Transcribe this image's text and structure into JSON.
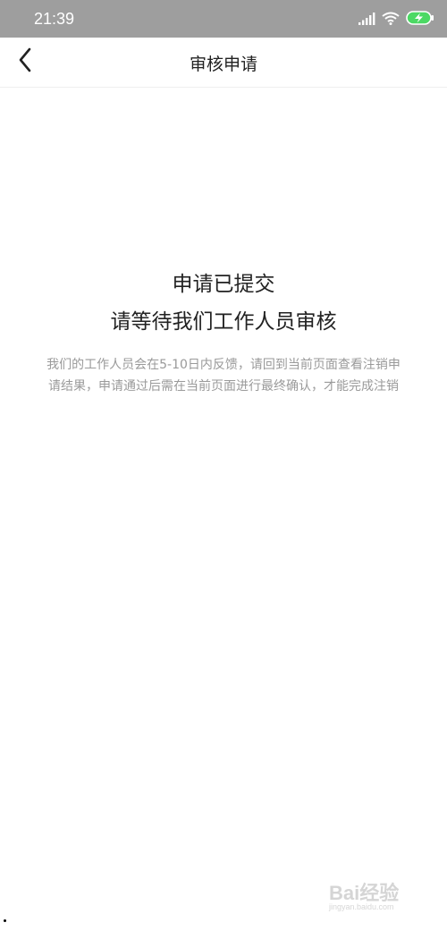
{
  "status_bar": {
    "time": "21:39",
    "icons": [
      "signal-icon",
      "wifi-icon",
      "battery-charging-icon"
    ],
    "battery_color": "#4cd964"
  },
  "nav": {
    "back_icon": "chevron-left-icon",
    "title": "审核申请"
  },
  "content": {
    "headline_line1": "申请已提交",
    "headline_line2": "请等待我们工作人员审核",
    "description_line1": "我们的工作人员会在5-10日内反馈，请回到当前页面查看注销申",
    "description_line2": "请结果，申请通过后需在当前页面进行最终确认，才能完成注销"
  },
  "watermark": {
    "brand": "Bai经验",
    "url": "jingyan.baidu.com"
  }
}
